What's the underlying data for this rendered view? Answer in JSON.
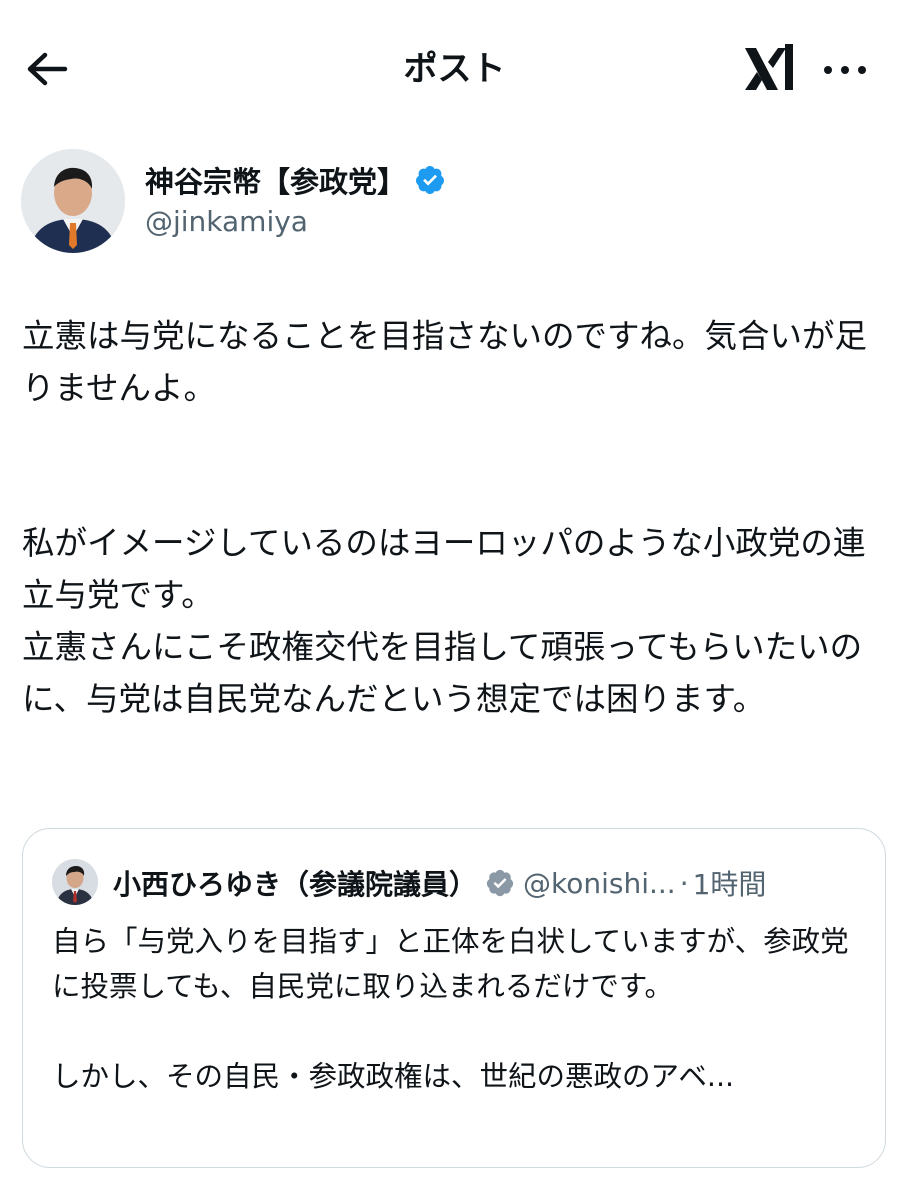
{
  "header": {
    "title": "ポスト",
    "back_icon": "arrow-left-icon",
    "logo_icon": "xai-logo-icon",
    "more_icon": "more-horizontal-icon"
  },
  "author": {
    "name": "神谷宗幣【参政党】",
    "handle": "@jinkamiya",
    "verified_color": "#1d9bf0"
  },
  "post": {
    "paragraphs": [
      "立憲は与党になることを目指さないのですね。気合いが足りませんよ。",
      "私がイメージしているのはヨーロッパのような小政党の連立与党です。\n立憲さんにこそ政権交代を目指して頑張ってもらいたいのに、与党は自民党なんだという想定では困ります。"
    ]
  },
  "quote": {
    "name": "小西ひろゆき（参議院議員）",
    "handle": "@konishi...",
    "separator": "·",
    "time": "1時間",
    "verified_color": "#8b98a5",
    "paragraphs": [
      "自ら「与党入りを目指す」と正体を白状していますが、参政党に投票しても、自民党に取り込まれるだけです。",
      "しかし、その自民・参政政権は、世紀の悪政のアベ..."
    ]
  },
  "colors": {
    "text": "#0f1419",
    "secondary": "#536471",
    "border": "#cfd9de",
    "accent": "#1d9bf0"
  }
}
